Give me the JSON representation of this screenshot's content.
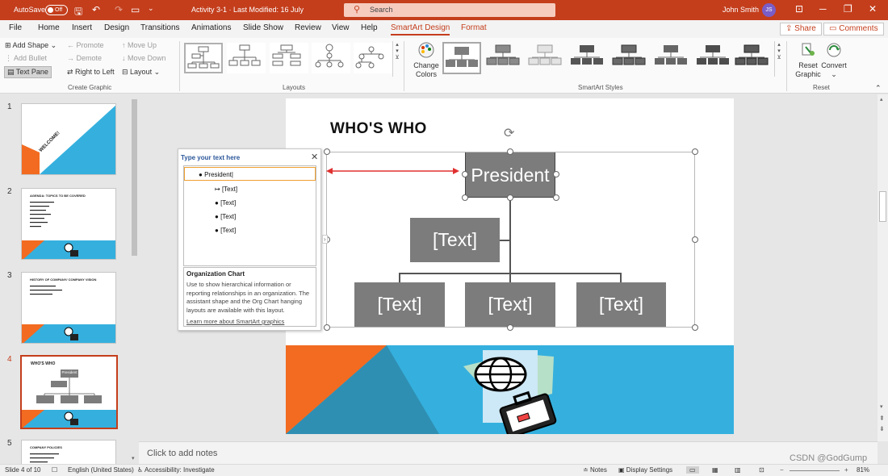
{
  "titlebar": {
    "autosave_label": "AutoSave",
    "autosave_state": "Off",
    "doc_title": "Activity 3-1  ·  Last Modified: 16 July",
    "search_placeholder": "Search",
    "user_name": "John Smith",
    "user_initials": "JS",
    "brand_color": "#c43e1c"
  },
  "menu": {
    "tabs": [
      "File",
      "Home",
      "Insert",
      "Design",
      "Transitions",
      "Animations",
      "Slide Show",
      "Review",
      "View",
      "Help",
      "SmartArt Design",
      "Format"
    ],
    "active_tab": "SmartArt Design",
    "share_label": "Share",
    "comments_label": "Comments"
  },
  "ribbon": {
    "create_graphic": {
      "add_shape": "Add Shape",
      "add_bullet": "Add Bullet",
      "text_pane": "Text Pane",
      "promote": "Promote",
      "demote": "Demote",
      "right_to_left": "Right to Left",
      "move_up": "Move Up",
      "move_down": "Move Down",
      "layout": "Layout",
      "group_label": "Create Graphic"
    },
    "layouts_label": "Layouts",
    "change_colors": "Change Colors",
    "smartart_styles_label": "SmartArt Styles",
    "reset_graphic": "Reset Graphic",
    "convert": "Convert",
    "reset_label": "Reset"
  },
  "slides_panel": {
    "slides": [
      {
        "number": "1",
        "title": "WELCOME!"
      },
      {
        "number": "2",
        "title": "AGENDA: TOPICS TO BE COVERED"
      },
      {
        "number": "3",
        "title": "HISTORY OF COMPANY/ COMPANY VISION"
      },
      {
        "number": "4",
        "title": "WHO'S WHO",
        "box": "President",
        "current": true
      },
      {
        "number": "5",
        "title": "COMPANY POLICIES"
      }
    ]
  },
  "slide": {
    "title": "WHO'S WHO",
    "org_chart": {
      "top": "President",
      "assistant": "[Text]",
      "subordinates": [
        "[Text]",
        "[Text]",
        "[Text]"
      ]
    }
  },
  "text_pane": {
    "title": "Type your text here",
    "items": [
      "President",
      "[Text]",
      "[Text]",
      "[Text]",
      "[Text]"
    ],
    "info_heading": "Organization Chart",
    "info_body": "Use to show hierarchical information or reporting relationships in an organization. The assistant shape and the Org Chart hanging layouts are available with this layout.",
    "learn_more": "Learn more about SmartArt graphics"
  },
  "notes": {
    "placeholder": "Click to add notes"
  },
  "status": {
    "slide_count": "Slide 4 of 10",
    "language": "English (United States)",
    "accessibility": "Accessibility: Investigate",
    "notes": "Notes",
    "display_settings": "Display Settings",
    "zoom": "81%",
    "watermark": "CSDN @GodGump"
  }
}
